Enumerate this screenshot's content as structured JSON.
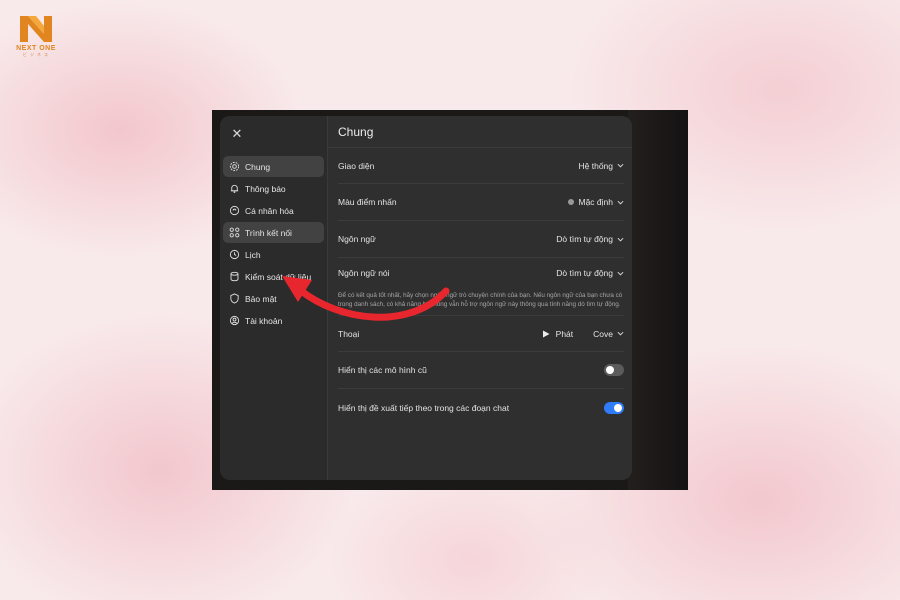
{
  "brand": {
    "name": "NEXT ONE",
    "tagline": "ビ ジ ネ ス",
    "color": "#e0851f"
  },
  "sidebar": {
    "items": [
      {
        "label": "Chung",
        "icon": "gear-icon",
        "active": true
      },
      {
        "label": "Thông báo",
        "icon": "bell-icon",
        "active": false
      },
      {
        "label": "Cá nhân hóa",
        "icon": "personalize-icon",
        "active": false
      },
      {
        "label": "Trình kết nối",
        "icon": "connector-icon",
        "active": true
      },
      {
        "label": "Lịch",
        "icon": "clock-icon",
        "active": false
      },
      {
        "label": "Kiểm soát dữ liệu",
        "icon": "database-icon",
        "active": false
      },
      {
        "label": "Bảo mật",
        "icon": "shield-icon",
        "active": false
      },
      {
        "label": "Tài khoản",
        "icon": "user-icon",
        "active": false
      }
    ]
  },
  "main": {
    "title": "Chung",
    "rows": {
      "theme": {
        "label": "Giao diện",
        "value": "Hệ thống"
      },
      "accent": {
        "label": "Màu điểm nhấn",
        "value": "Mặc định",
        "dot_color": "#9a9a9a"
      },
      "language": {
        "label": "Ngôn ngữ",
        "value": "Dò tìm tự động"
      },
      "spoken_language": {
        "label": "Ngôn ngữ nói",
        "value": "Dò tìm tự động"
      },
      "spoken_hint": "Để có kết quả tốt nhất, hãy chọn ngôn ngữ trò chuyện chính của bạn. Nếu ngôn ngữ của bạn chưa có trong danh sách, có khả năng hệ thống vẫn hỗ trợ ngôn ngữ này thông qua tính năng dò tìm tự động.",
      "voice": {
        "label": "Thoại",
        "play_label": "Phát",
        "value": "Cove"
      },
      "legacy_models": {
        "label": "Hiển thị các mô hình cũ",
        "on": false
      },
      "follow_up": {
        "label": "Hiển thị đề xuất tiếp theo trong các đoạn chat",
        "on": true,
        "color": "#2f7cf6"
      }
    }
  },
  "annotation": {
    "arrow_color": "#e8262d"
  }
}
